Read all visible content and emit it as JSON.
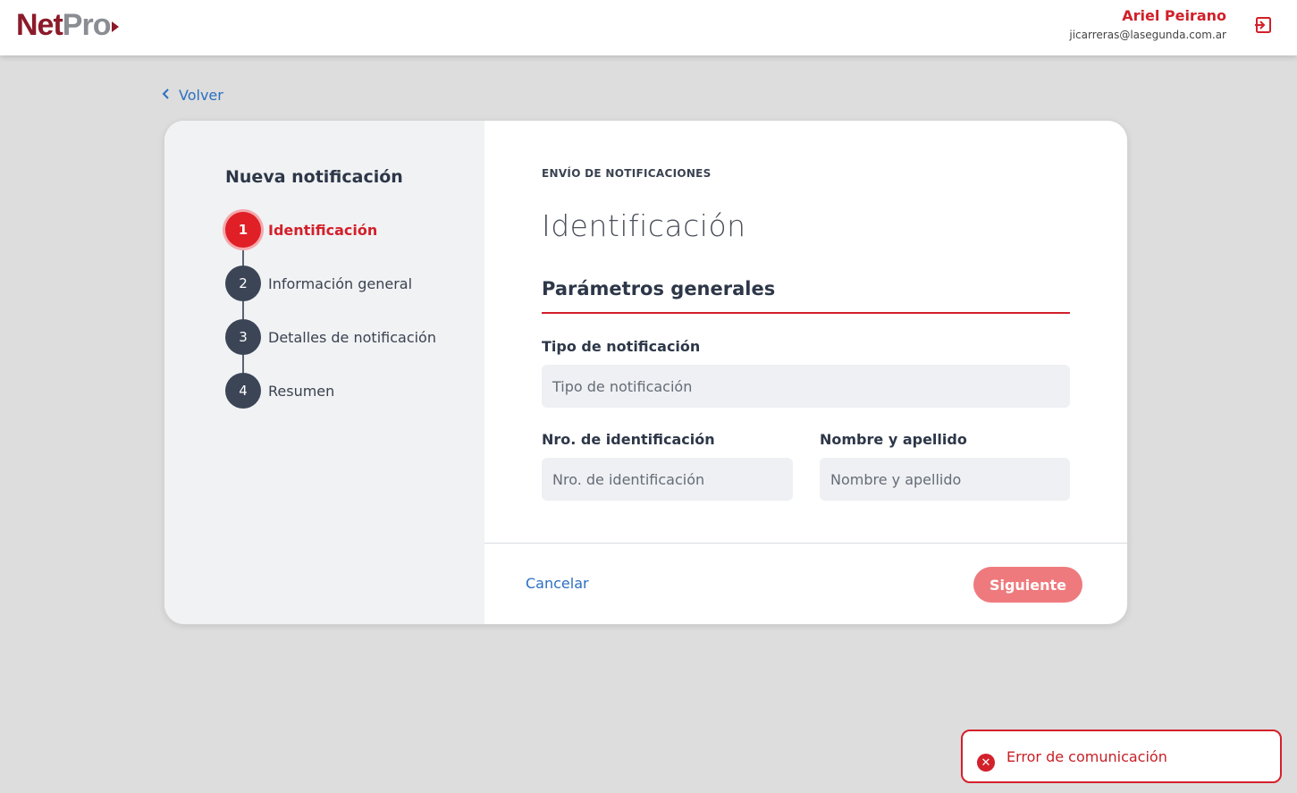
{
  "app": {
    "logo_net": "Net",
    "logo_pro": "Pro"
  },
  "user": {
    "name": "Ariel Peirano",
    "email": "jicarreras@lasegunda.com.ar"
  },
  "icons": {
    "logout": "logout-icon",
    "back": "chevron-left-icon",
    "error": "error-circle-icon"
  },
  "nav": {
    "back_label": "Volver"
  },
  "sidebar": {
    "title": "Nueva notificación",
    "steps": [
      {
        "number": "1",
        "label": "Identificación",
        "active": true
      },
      {
        "number": "2",
        "label": "Información general",
        "active": false
      },
      {
        "number": "3",
        "label": "Detalles de notificación",
        "active": false
      },
      {
        "number": "4",
        "label": "Resumen",
        "active": false
      }
    ]
  },
  "main": {
    "eyebrow": "ENVÍO DE NOTIFICACIONES",
    "title": "Identificación",
    "section_title": "Parámetros generales",
    "fields": {
      "tipo": {
        "label": "Tipo de notificación",
        "placeholder": "Tipo de notificación",
        "value": ""
      },
      "nro": {
        "label": "Nro. de identificación",
        "placeholder": "Nro. de identificación",
        "value": ""
      },
      "nombre": {
        "label": "Nombre y apellido",
        "placeholder": "Nombre y apellido",
        "value": ""
      }
    }
  },
  "footer": {
    "cancel_label": "Cancelar",
    "next_label": "Siguiente"
  },
  "toast": {
    "message": "Error de comunicación"
  },
  "colors": {
    "brand_red": "#d3202a",
    "brand_dark": "#8b1a2a",
    "link_blue": "#2c6fc1",
    "next_button": "#ee7a7d",
    "step_dark": "#3b4556"
  }
}
